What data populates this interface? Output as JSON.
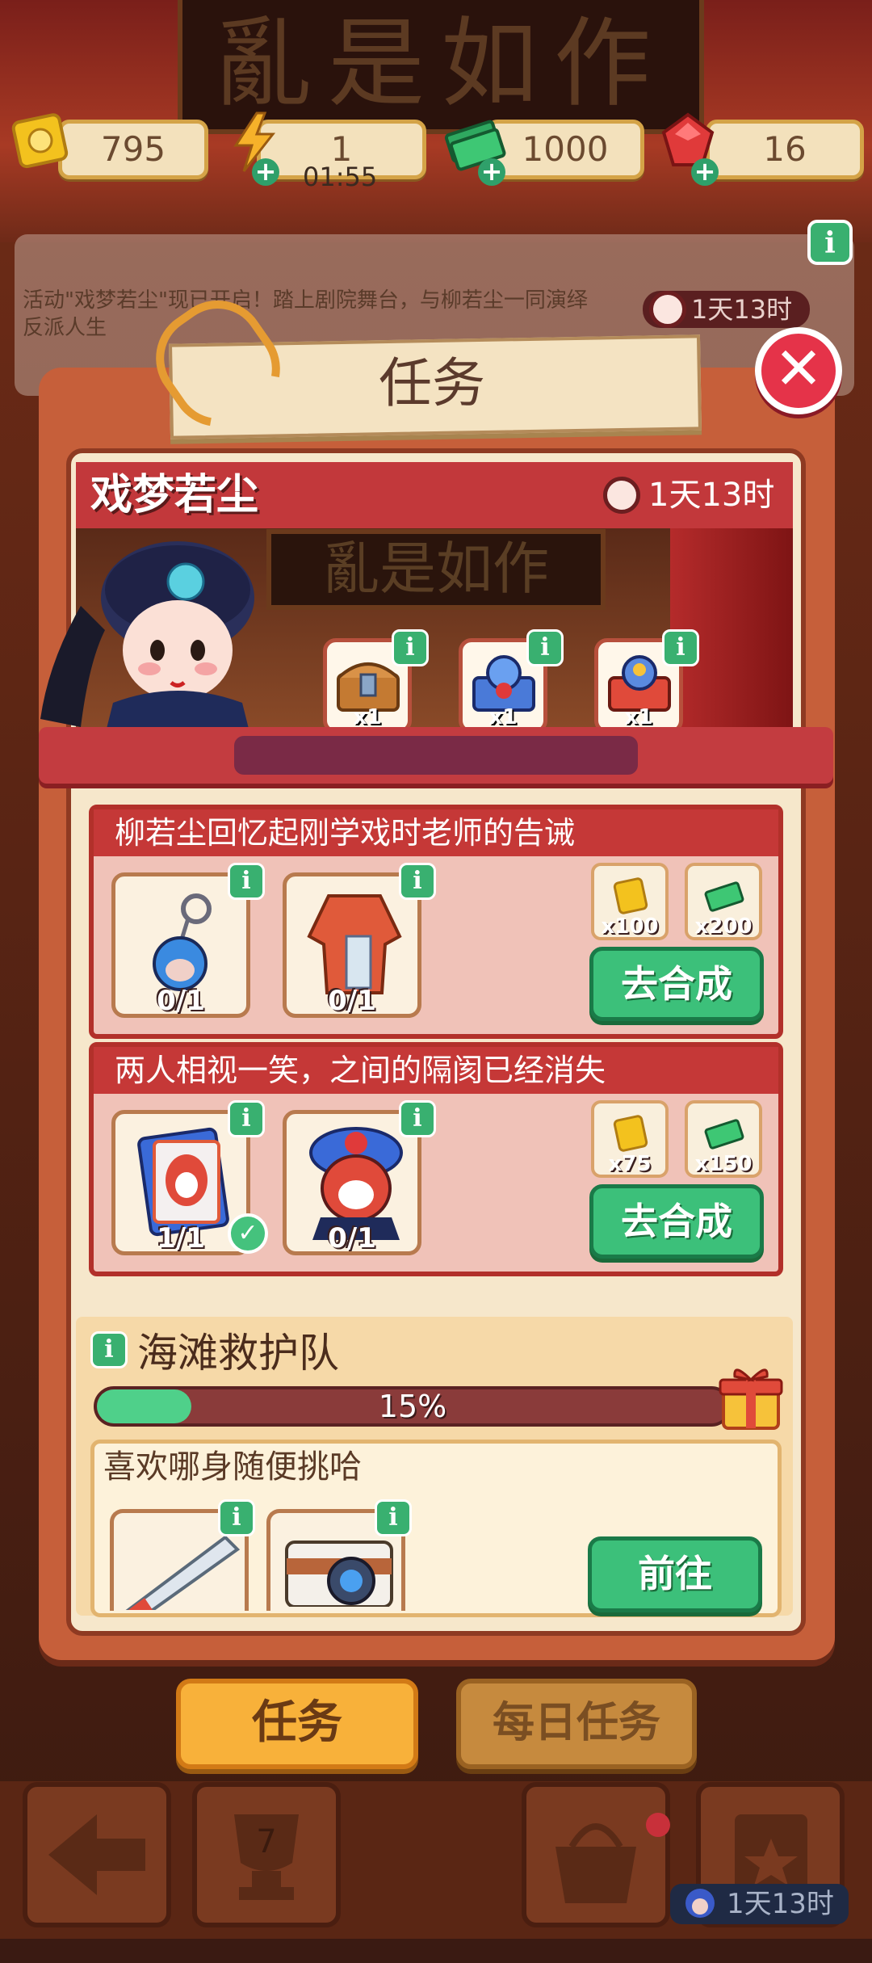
{
  "background": {
    "plaque_text": "亂是如作"
  },
  "resources": [
    {
      "name": "ticket",
      "value": "795",
      "icon": "ticket-icon"
    },
    {
      "name": "energy",
      "value": "1",
      "timer": "01:55",
      "icon": "lightning-icon"
    },
    {
      "name": "cash",
      "value": "1000",
      "icon": "cash-icon"
    },
    {
      "name": "gem",
      "value": "16",
      "icon": "ruby-icon"
    }
  ],
  "notice": {
    "text": "活动\"戏梦若尘\"现已开启！踏上剧院舞台，与柳若尘一同演绎反派人生",
    "timer": "1天13时"
  },
  "dialog": {
    "title": "任务",
    "event": {
      "name": "戏梦若尘",
      "timer": "1天13时",
      "stage_plaque": "亂是如作",
      "rewards": [
        {
          "icon": "treasure-chest-icon",
          "count": "x1"
        },
        {
          "icon": "blue-chest-icon",
          "count": "x1"
        },
        {
          "icon": "red-chest-icon",
          "count": "x1"
        }
      ]
    },
    "quests": [
      {
        "title": "柳若尘回忆起刚学戏时老师的告诫",
        "items": [
          {
            "icon": "opera-mask-keychain-icon",
            "progress": "0/1",
            "done": false
          },
          {
            "icon": "opera-robe-icon",
            "progress": "0/1",
            "done": false
          }
        ],
        "rewards": [
          {
            "icon": "ticket-icon",
            "count": "x100"
          },
          {
            "icon": "cash-icon",
            "count": "x200"
          }
        ],
        "button": "去合成"
      },
      {
        "title": "两人相视一笑，之间的隔阂已经消失",
        "items": [
          {
            "icon": "opera-mask-card-icon",
            "progress": "1/1",
            "done": true
          },
          {
            "icon": "opera-figure-icon",
            "progress": "0/1",
            "done": false
          }
        ],
        "rewards": [
          {
            "icon": "ticket-icon",
            "count": "x75"
          },
          {
            "icon": "cash-icon",
            "count": "x150"
          }
        ],
        "button": "去合成"
      }
    ],
    "beach": {
      "title": "海滩救护队",
      "progress_text": "15%",
      "progress": 0.15,
      "quest_title": "喜欢哪身随便挑哈",
      "items": [
        {
          "icon": "saw-icon"
        },
        {
          "icon": "camera-icon"
        }
      ],
      "button": "前往"
    }
  },
  "tabs": {
    "task": "任务",
    "daily": "每日任务"
  },
  "bottom": {
    "trophy_count": "7",
    "timer": "1天13时"
  }
}
